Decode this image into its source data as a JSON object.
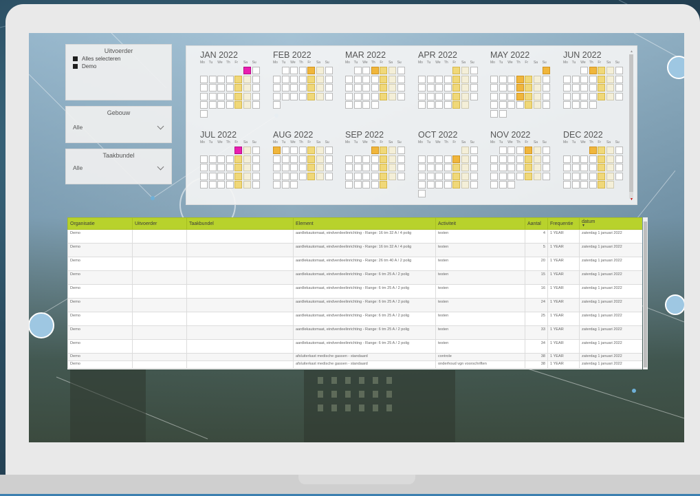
{
  "slicers": {
    "uitvoerder": {
      "title": "Uitvoerder",
      "options": [
        "Alles selecteren",
        "Demo"
      ]
    },
    "gebouw": {
      "title": "Gebouw",
      "value": "Alle"
    },
    "taakbundel": {
      "title": "Taakbundel",
      "value": "Alle"
    }
  },
  "calendar": {
    "weekdays": [
      "Mo",
      "Tu",
      "We",
      "Th",
      "Fr",
      "Sa",
      "Su"
    ],
    "months": [
      {
        "name": "JAN 2022"
      },
      {
        "name": "FEB 2022"
      },
      {
        "name": "MAR 2022"
      },
      {
        "name": "APR 2022"
      },
      {
        "name": "MAY 2022"
      },
      {
        "name": "JUN 2022"
      },
      {
        "name": "JUL 2022"
      },
      {
        "name": "AUG 2022"
      },
      {
        "name": "SEP 2022"
      },
      {
        "name": "OCT 2022"
      },
      {
        "name": "NOV 2022"
      },
      {
        "name": "DEC 2022"
      }
    ]
  },
  "table": {
    "columns": [
      "Organisatie",
      "Uitvoerder",
      "Taakbundel",
      "Element",
      "Activiteit",
      "Aantal",
      "Frequentie",
      "datum"
    ],
    "sort_indicator": "▼",
    "rows": [
      [
        "Demo",
        "",
        "",
        "aardlekautomaat, eindverdeelinrichting - Range: 16 tm 32 A / 4 polig",
        "testen",
        "4",
        "1 YEAR",
        "zaterdag 1 januari 2022"
      ],
      [
        "Demo",
        "",
        "",
        "aardlekautomaat, eindverdeelinrichting - Range: 16 tm 32 A / 4 polig",
        "testen",
        "5",
        "1 YEAR",
        "zaterdag 1 januari 2022"
      ],
      [
        "Demo",
        "",
        "",
        "aardlekautomaat, eindverdeelinrichting - Range: 26 tm 40 A / 2 polig",
        "testen",
        "20",
        "1 YEAR",
        "zaterdag 1 januari 2022"
      ],
      [
        "Demo",
        "",
        "",
        "aardlekautomaat, eindverdeelinrichting - Range: 6 tm 25 A / 2 polig",
        "testen",
        "15",
        "1 YEAR",
        "zaterdag 1 januari 2022"
      ],
      [
        "Demo",
        "",
        "",
        "aardlekautomaat, eindverdeelinrichting - Range: 6 tm 25 A / 2 polig",
        "testen",
        "16",
        "1 YEAR",
        "zaterdag 1 januari 2022"
      ],
      [
        "Demo",
        "",
        "",
        "aardlekautomaat, eindverdeelinrichting - Range: 6 tm 25 A / 2 polig",
        "testen",
        "24",
        "1 YEAR",
        "zaterdag 1 januari 2022"
      ],
      [
        "Demo",
        "",
        "",
        "aardlekautomaat, eindverdeelinrichting - Range: 6 tm 25 A / 2 polig",
        "testen",
        "25",
        "1 YEAR",
        "zaterdag 1 januari 2022"
      ],
      [
        "Demo",
        "",
        "",
        "aardlekautomaat, eindverdeelinrichting - Range: 6 tm 25 A / 2 polig",
        "testen",
        "33",
        "1 YEAR",
        "zaterdag 1 januari 2022"
      ],
      [
        "Demo",
        "",
        "",
        "aardlekautomaat, eindverdeelinrichting - Range: 6 tm 25 A / 2 polig",
        "testen",
        "34",
        "1 YEAR",
        "zaterdag 1 januari 2022"
      ],
      [
        "Demo",
        "",
        "",
        "afsluiterkast medische gassen - standaard",
        "controle",
        "38",
        "1 YEAR",
        "zaterdag 1 januari 2022"
      ],
      [
        "Demo",
        "",
        "",
        "afsluiterkast medische gassen - standaard",
        "onderhoud vgn voorschriften",
        "38",
        "1 YEAR",
        "zaterdag 1 januari 2022"
      ]
    ]
  },
  "colors": {
    "header": "#b8d22c",
    "highlight": "#f0b63c",
    "today": "#e91eb0",
    "accent": "#3c7fb0"
  }
}
